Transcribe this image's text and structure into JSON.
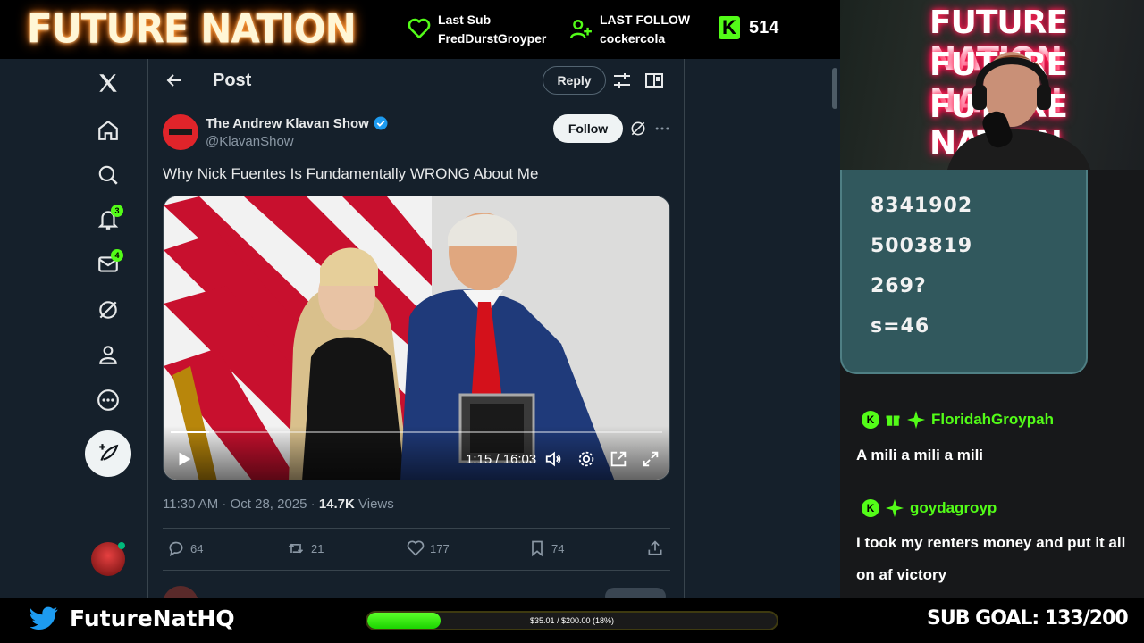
{
  "overlay": {
    "brand": "FUTURE NATION",
    "last_sub": {
      "label": "Last Sub",
      "name": "FredDurstGroyper"
    },
    "last_follow": {
      "label": "LAST FOLLOW",
      "name": "cockercola"
    },
    "kick_viewers": "514",
    "kick_letter": "K",
    "camera_sign": [
      "FUTURE NATION",
      "FUTURE NATION",
      "FUTURE NATION"
    ],
    "twitter_handle": "FutureNatHQ",
    "donation": {
      "text": "$35.01 / $200.00 (18%)",
      "fraction": 0.18
    },
    "sub_goal": "SUB GOAL: 133/200"
  },
  "goal_card": {
    "lines": [
      "8341902",
      "5003819",
      "269?",
      "s=46"
    ]
  },
  "chat": [
    {
      "user": "FloridahGroypah",
      "message": "A mili a mili a mili",
      "badge": "K"
    },
    {
      "user": "goydagroyp",
      "message": "I took my renters money and put it all on af victory",
      "badge": "K"
    }
  ],
  "x": {
    "nav": [
      {
        "name": "x-logo-icon"
      },
      {
        "name": "home-icon"
      },
      {
        "name": "search-icon"
      },
      {
        "name": "notifications-icon",
        "badge": "3"
      },
      {
        "name": "messages-icon",
        "badge": "4"
      },
      {
        "name": "grok-icon"
      },
      {
        "name": "profile-icon"
      },
      {
        "name": "more-icon"
      }
    ],
    "header": {
      "title": "Post",
      "reply_label": "Reply"
    },
    "post": {
      "author_name": "The Andrew Klavan Show",
      "author_handle": "@KlavanShow",
      "follow_label": "Follow",
      "text": "Why Nick Fuentes Is Fundamentally WRONG About Me",
      "video": {
        "time": "1:15 / 16:03",
        "progress": 0.078
      },
      "timestamp": "11:30 AM · Oct 28, 2025 · ",
      "views_count": "14.7K",
      "views_label": " Views",
      "stats": {
        "replies": "64",
        "reposts": "21",
        "likes": "177",
        "bookmarks": "74"
      }
    }
  },
  "colors": {
    "kick_green": "#53fc18",
    "x_bg": "#15202b",
    "verified_blue": "#1d9bf0",
    "goal_card": "#31585d"
  }
}
